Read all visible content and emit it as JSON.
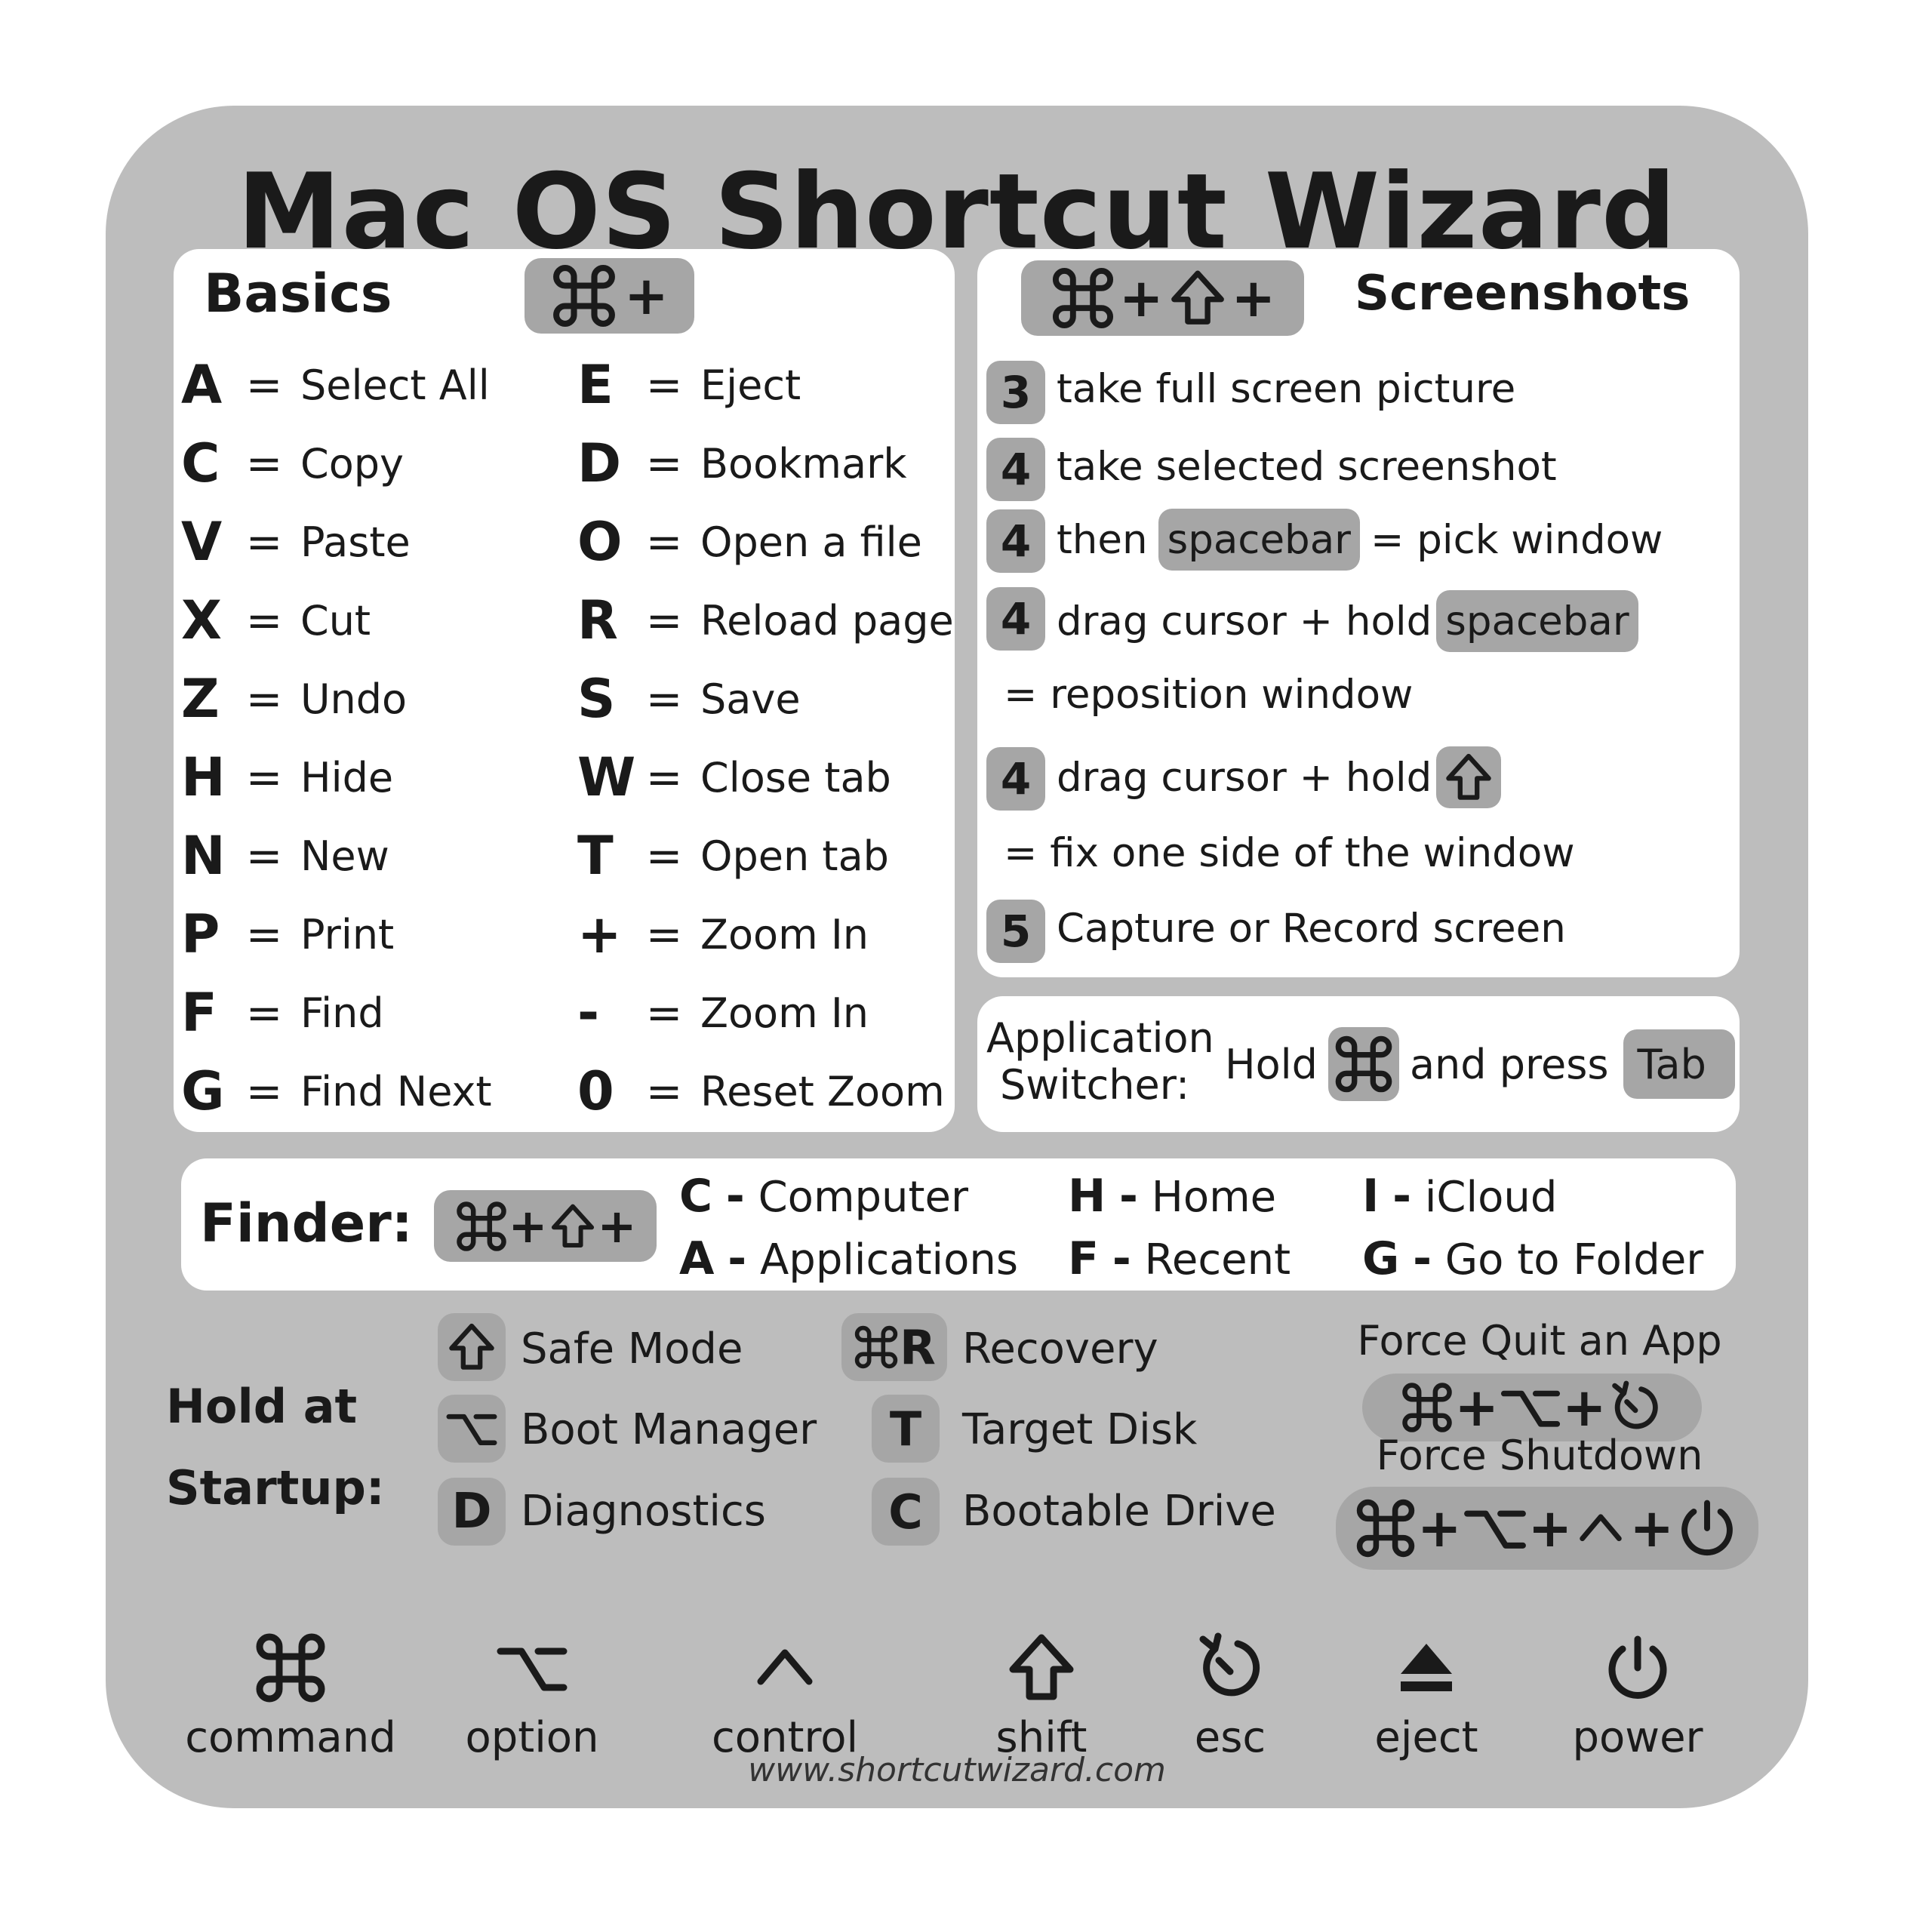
{
  "title": "Mac OS Shortcut Wizard",
  "basics": {
    "heading": "Basics",
    "modifier": "+",
    "left": [
      {
        "key": "A",
        "eq": "=",
        "label": "Select All"
      },
      {
        "key": "C",
        "eq": "=",
        "label": "Copy"
      },
      {
        "key": "V",
        "eq": "=",
        "label": "Paste"
      },
      {
        "key": "X",
        "eq": "=",
        "label": "Cut"
      },
      {
        "key": "Z",
        "eq": "=",
        "label": "Undo"
      },
      {
        "key": "H",
        "eq": "=",
        "label": "Hide"
      },
      {
        "key": "N",
        "eq": "=",
        "label": "New"
      },
      {
        "key": "P",
        "eq": "=",
        "label": "Print"
      },
      {
        "key": "F",
        "eq": "=",
        "label": "Find"
      },
      {
        "key": "G",
        "eq": "=",
        "label": "Find Next"
      }
    ],
    "right": [
      {
        "key": "E",
        "eq": "=",
        "label": "Eject"
      },
      {
        "key": "D",
        "eq": "=",
        "label": "Bookmark"
      },
      {
        "key": "O",
        "eq": "=",
        "label": "Open a file"
      },
      {
        "key": "R",
        "eq": "=",
        "label": "Reload page"
      },
      {
        "key": "S",
        "eq": "=",
        "label": "Save"
      },
      {
        "key": "W",
        "eq": "=",
        "label": "Close tab"
      },
      {
        "key": "T",
        "eq": "=",
        "label": "Open tab"
      },
      {
        "key": "+",
        "eq": "=",
        "label": "Zoom In"
      },
      {
        "key": "-",
        "eq": "=",
        "label": "Zoom In"
      },
      {
        "key": "0",
        "eq": "=",
        "label": "Reset Zoom"
      }
    ]
  },
  "screenshots": {
    "heading": "Screenshots",
    "plus": "+",
    "rows": [
      {
        "num": "3",
        "text": "take full screen picture"
      },
      {
        "num": "4",
        "text": "take selected screenshot"
      },
      {
        "num": "4",
        "pre": "then",
        "key": "spacebar",
        "post": "= pick window"
      },
      {
        "num": "4",
        "pre": "drag cursor + hold",
        "key": "spacebar"
      },
      {
        "text": "= reposition window"
      },
      {
        "num": "4",
        "pre": "drag cursor + hold"
      },
      {
        "text": "= fix one side of the window"
      },
      {
        "num": "5",
        "text": "Capture or Record screen"
      }
    ]
  },
  "switcher": {
    "label_line1": "Application",
    "label_line2": "Switcher:",
    "hold": "Hold",
    "and_press": "and press",
    "tab_key": "Tab"
  },
  "finder": {
    "label": "Finder:",
    "items": [
      {
        "key": "C",
        "dash": "-",
        "label": "Computer"
      },
      {
        "key": "A",
        "dash": "-",
        "label": "Applications"
      },
      {
        "key": "H",
        "dash": "-",
        "label": "Home"
      },
      {
        "key": "F",
        "dash": "-",
        "label": "Recent"
      },
      {
        "key": "I",
        "dash": "-",
        "label": "iCloud"
      },
      {
        "key": "G",
        "dash": "-",
        "label": "Go to Folder"
      }
    ]
  },
  "startup": {
    "label_line1": "Hold at",
    "label_line2": "Startup:",
    "items": [
      {
        "key_icon": "shift-icon",
        "label": "Safe Mode"
      },
      {
        "key_icon": "option-icon",
        "label": "Boot Manager"
      },
      {
        "key": "D",
        "label": "Diagnostics"
      },
      {
        "key": "R",
        "key_icon": "command-icon",
        "label": "Recovery"
      },
      {
        "key": "T",
        "label": "Target Disk"
      },
      {
        "key": "C",
        "label": "Bootable Drive"
      }
    ],
    "force_quit": "Force Quit an App",
    "force_shutdown": "Force Shutdown",
    "plus": "+"
  },
  "legend": [
    {
      "icon": "command-icon",
      "label": "command"
    },
    {
      "icon": "option-icon",
      "label": "option"
    },
    {
      "icon": "control-icon",
      "label": "control"
    },
    {
      "icon": "shift-icon",
      "label": "shift"
    },
    {
      "icon": "esc-icon",
      "label": "esc"
    },
    {
      "icon": "eject-icon",
      "label": "eject"
    },
    {
      "icon": "power-icon",
      "label": "power"
    }
  ],
  "website": "www.shortcutwizard.com",
  "colors": {
    "card": "#bdbdbd",
    "key": "#a6a6a6",
    "panel": "#ffffff",
    "text": "#1a1a1a"
  }
}
